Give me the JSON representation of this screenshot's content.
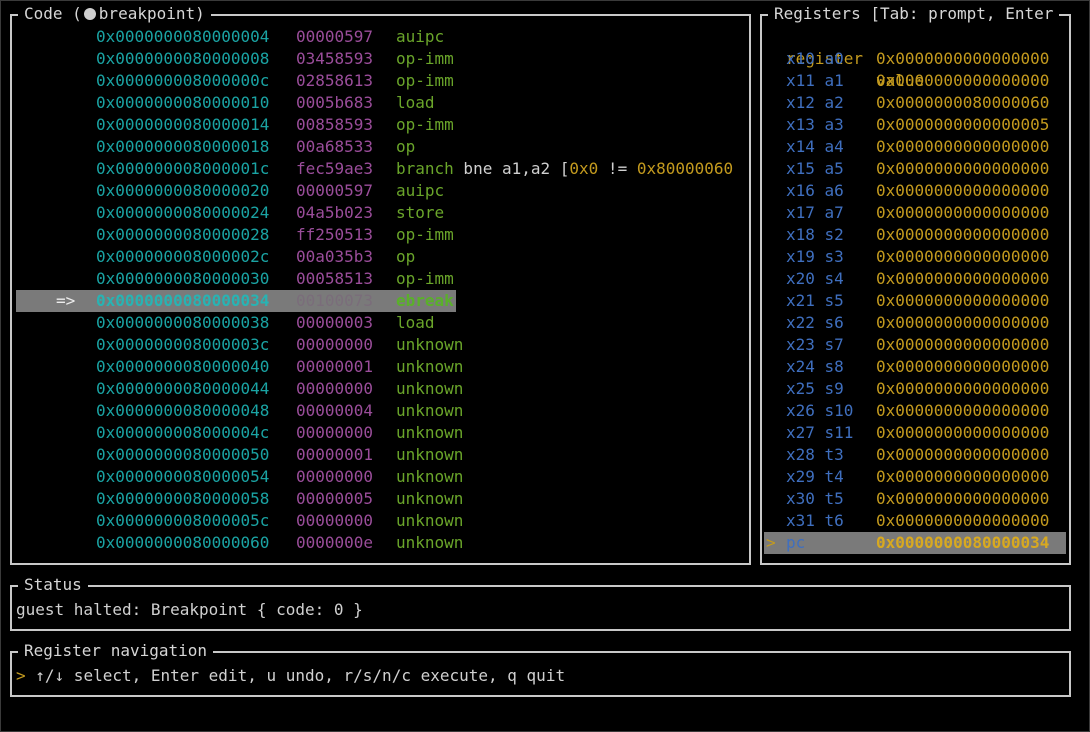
{
  "code_panel": {
    "title_prefix": "Code (",
    "title_suffix": "breakpoint)",
    "rows": [
      {
        "marker": "",
        "addr": "0x0000000080000004",
        "hex": "00000597",
        "op": "auipc",
        "extra": ""
      },
      {
        "marker": "",
        "addr": "0x0000000080000008",
        "hex": "03458593",
        "op": "op-imm",
        "extra": ""
      },
      {
        "marker": "",
        "addr": "0x000000008000000c",
        "hex": "02858613",
        "op": "op-imm",
        "extra": ""
      },
      {
        "marker": "",
        "addr": "0x0000000080000010",
        "hex": "0005b683",
        "op": "load",
        "extra": ""
      },
      {
        "marker": "",
        "addr": "0x0000000080000014",
        "hex": "00858593",
        "op": "op-imm",
        "extra": ""
      },
      {
        "marker": "",
        "addr": "0x0000000080000018",
        "hex": "00a68533",
        "op": "op",
        "extra": ""
      },
      {
        "marker": "",
        "addr": "0x000000008000001c",
        "hex": "fec59ae3",
        "op": "branch",
        "extra": " bne a1,a2 [0x0 != 0x80000060"
      },
      {
        "marker": "",
        "addr": "0x0000000080000020",
        "hex": "00000597",
        "op": "auipc",
        "extra": ""
      },
      {
        "marker": "",
        "addr": "0x0000000080000024",
        "hex": "04a5b023",
        "op": "store",
        "extra": ""
      },
      {
        "marker": "",
        "addr": "0x0000000080000028",
        "hex": "ff250513",
        "op": "op-imm",
        "extra": ""
      },
      {
        "marker": "",
        "addr": "0x000000008000002c",
        "hex": "00a035b3",
        "op": "op",
        "extra": ""
      },
      {
        "marker": "",
        "addr": "0x0000000080000030",
        "hex": "00058513",
        "op": "op-imm",
        "extra": ""
      },
      {
        "marker": "=>",
        "addr": "0x0000000080000034",
        "hex": "00100073",
        "op": "ebreak",
        "extra": "",
        "current": true
      },
      {
        "marker": "",
        "addr": "0x0000000080000038",
        "hex": "00000003",
        "op": "load",
        "extra": ""
      },
      {
        "marker": "",
        "addr": "0x000000008000003c",
        "hex": "00000000",
        "op": "unknown",
        "extra": ""
      },
      {
        "marker": "",
        "addr": "0x0000000080000040",
        "hex": "00000001",
        "op": "unknown",
        "extra": ""
      },
      {
        "marker": "",
        "addr": "0x0000000080000044",
        "hex": "00000000",
        "op": "unknown",
        "extra": ""
      },
      {
        "marker": "",
        "addr": "0x0000000080000048",
        "hex": "00000004",
        "op": "unknown",
        "extra": ""
      },
      {
        "marker": "",
        "addr": "0x000000008000004c",
        "hex": "00000000",
        "op": "unknown",
        "extra": ""
      },
      {
        "marker": "",
        "addr": "0x0000000080000050",
        "hex": "00000001",
        "op": "unknown",
        "extra": ""
      },
      {
        "marker": "",
        "addr": "0x0000000080000054",
        "hex": "00000000",
        "op": "unknown",
        "extra": ""
      },
      {
        "marker": "",
        "addr": "0x0000000080000058",
        "hex": "00000005",
        "op": "unknown",
        "extra": ""
      },
      {
        "marker": "",
        "addr": "0x000000008000005c",
        "hex": "00000000",
        "op": "unknown",
        "extra": ""
      },
      {
        "marker": "",
        "addr": "0x0000000080000060",
        "hex": "0000000e",
        "op": "unknown",
        "extra": ""
      }
    ]
  },
  "registers_panel": {
    "title": "Registers [Tab: prompt, Enter",
    "header": {
      "register": "register",
      "value": "value"
    },
    "rows": [
      {
        "name": "x10 a0",
        "value": "0x0000000000000000"
      },
      {
        "name": "x11 a1",
        "value": "0x0000000000000000"
      },
      {
        "name": "x12 a2",
        "value": "0x0000000080000060"
      },
      {
        "name": "x13 a3",
        "value": "0x0000000000000005"
      },
      {
        "name": "x14 a4",
        "value": "0x0000000000000000"
      },
      {
        "name": "x15 a5",
        "value": "0x0000000000000000"
      },
      {
        "name": "x16 a6",
        "value": "0x0000000000000000"
      },
      {
        "name": "x17 a7",
        "value": "0x0000000000000000"
      },
      {
        "name": "x18 s2",
        "value": "0x0000000000000000"
      },
      {
        "name": "x19 s3",
        "value": "0x0000000000000000"
      },
      {
        "name": "x20 s4",
        "value": "0x0000000000000000"
      },
      {
        "name": "x21 s5",
        "value": "0x0000000000000000"
      },
      {
        "name": "x22 s6",
        "value": "0x0000000000000000"
      },
      {
        "name": "x23 s7",
        "value": "0x0000000000000000"
      },
      {
        "name": "x24 s8",
        "value": "0x0000000000000000"
      },
      {
        "name": "x25 s9",
        "value": "0x0000000000000000"
      },
      {
        "name": "x26 s10",
        "value": "0x0000000000000000"
      },
      {
        "name": "x27 s11",
        "value": "0x0000000000000000"
      },
      {
        "name": "x28 t3",
        "value": "0x0000000000000000"
      },
      {
        "name": "x29 t4",
        "value": "0x0000000000000000"
      },
      {
        "name": "x30 t5",
        "value": "0x0000000000000000"
      },
      {
        "name": "x31 t6",
        "value": "0x0000000000000000"
      },
      {
        "name": "pc",
        "value": "0x0000000080000034",
        "selected": true,
        "marker": ">"
      }
    ]
  },
  "status_panel": {
    "title": "Status",
    "text": "guest halted: Breakpoint { code: 0 }"
  },
  "nav_panel": {
    "title": "Register navigation",
    "prompt": ">",
    "text": " ↑/↓ select, Enter edit, u undo, r/s/n/c execute, q quit"
  },
  "colors": {
    "address": "#1aa3a3",
    "hex": "#9a4d9a",
    "opcode": "#6aa52a",
    "register_name": "#3f6fbf",
    "register_value": "#c39a1e",
    "highlight_bg": "#7a7a7a"
  }
}
